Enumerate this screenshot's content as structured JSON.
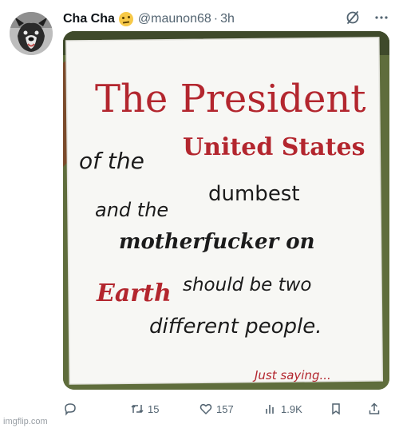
{
  "tweet": {
    "author_name": "Cha Cha",
    "handle": "@maunon68",
    "separator": "·",
    "time": "3h",
    "author_emoji": "face-with-raised-eyebrow-emoji"
  },
  "sign": {
    "line1": "The President",
    "line2a": "of the",
    "line2b": "United States",
    "line3a": "and the",
    "line3b": "dumbest",
    "line4": "motherfucker on",
    "line5a": "Earth",
    "line5b": "should be two",
    "line6": "different people.",
    "line7": "Just saying..."
  },
  "actions": {
    "reply_count": "",
    "retweet_count": "15",
    "like_count": "157",
    "views_count": "1.9K"
  },
  "watermark": "imgflip.com",
  "colors": {
    "accent": "#1d9bf0",
    "text_primary": "#0f1419",
    "text_secondary": "#536471",
    "sign_red": "#b3262e",
    "sign_ink": "#1b1b1b"
  }
}
